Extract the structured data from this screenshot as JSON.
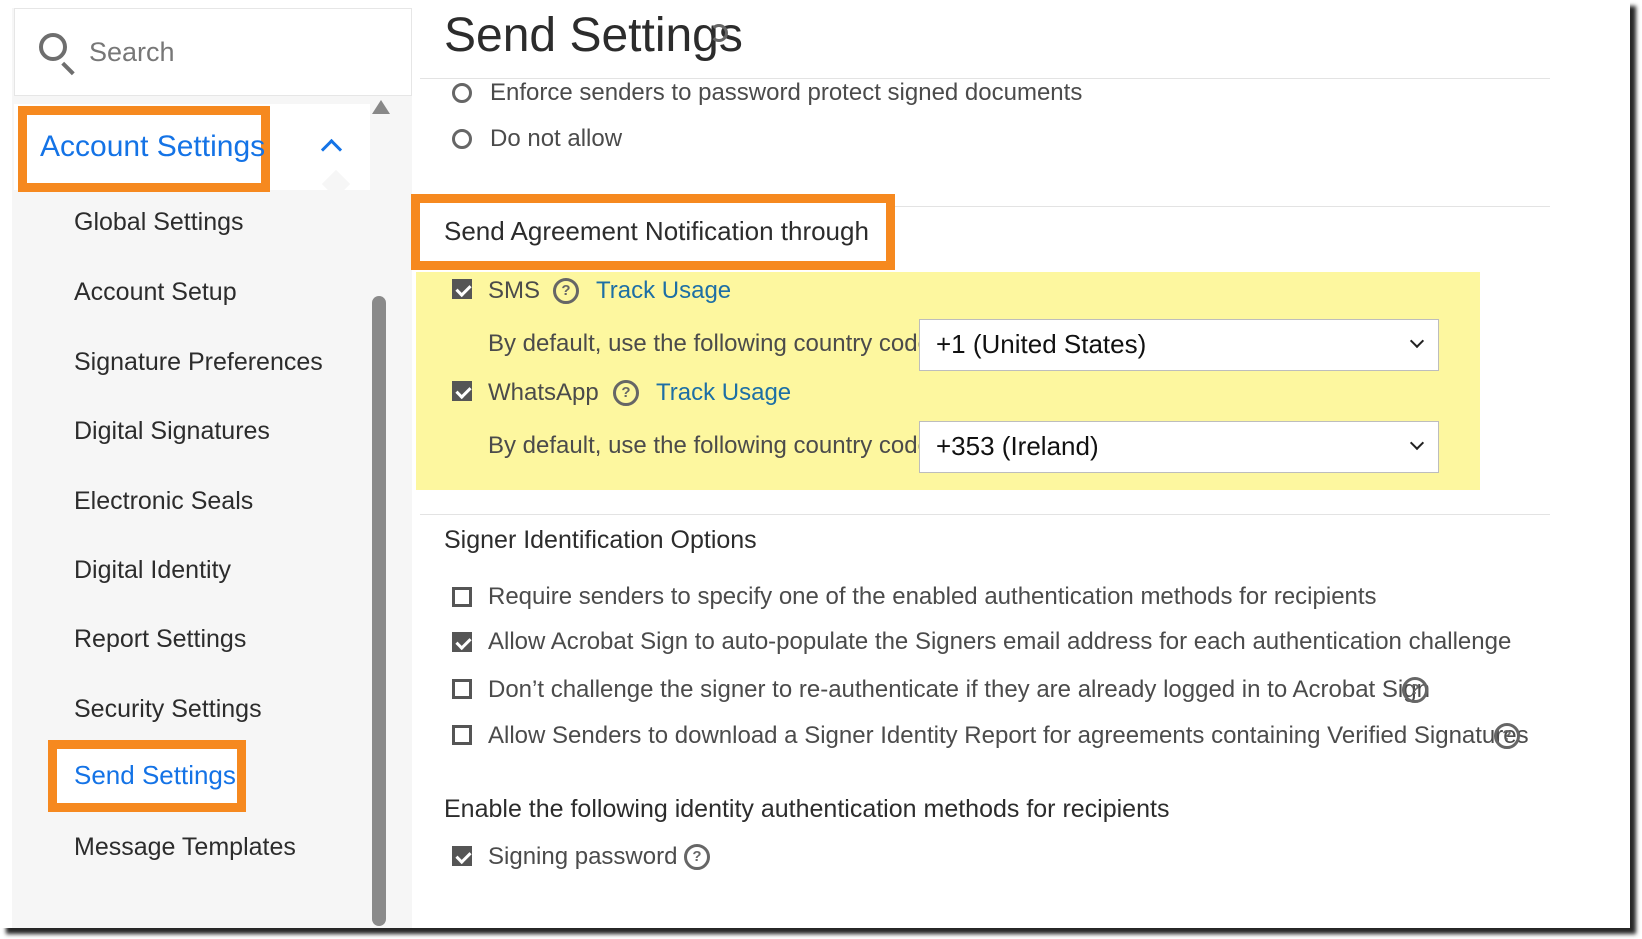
{
  "sidebar": {
    "search_placeholder": "Search",
    "section_label": "Account Settings",
    "items": [
      {
        "label": "Global Settings"
      },
      {
        "label": "Account Setup"
      },
      {
        "label": "Signature Preferences"
      },
      {
        "label": "Digital Signatures"
      },
      {
        "label": "Electronic Seals"
      },
      {
        "label": "Digital Identity"
      },
      {
        "label": "Report Settings"
      },
      {
        "label": "Security Settings"
      },
      {
        "label": "Send Settings"
      },
      {
        "label": "Message Templates"
      }
    ],
    "active_item": "Send Settings"
  },
  "main": {
    "title": "Send Settings",
    "password_options": [
      "Enforce senders to password protect signed documents",
      "Do not allow"
    ],
    "notification": {
      "title": "Send Agreement Notification through",
      "sms": {
        "label": "SMS",
        "checked": true,
        "link": "Track Usage",
        "country_label": "By default, use the following country code:",
        "country_value": "+1 (United States)"
      },
      "whatsapp": {
        "label": "WhatsApp",
        "checked": true,
        "link": "Track Usage",
        "country_label": "By default, use the following country code:",
        "country_value": "+353 (Ireland)"
      }
    },
    "signer_id": {
      "title": "Signer Identification Options",
      "options": [
        {
          "label": "Require senders to specify one of the enabled authentication methods for recipients",
          "checked": false
        },
        {
          "label": "Allow Acrobat Sign to auto-populate the Signers email address for each authentication challenge",
          "checked": true
        },
        {
          "label": "Don’t challenge the signer to re-authenticate if they are already logged in to Acrobat Sign",
          "checked": false
        },
        {
          "label": "Allow Senders to download a Signer Identity Report for agreements containing Verified Signatures",
          "checked": false
        }
      ]
    },
    "identity_methods": {
      "title": "Enable the following identity authentication methods for recipients",
      "options": [
        {
          "label": "Signing password",
          "checked": true
        }
      ]
    },
    "help_glyph": "?"
  },
  "colors": {
    "highlight": "#f6891f",
    "accent": "#1473e6",
    "yellow_band": "#fdf79f"
  }
}
